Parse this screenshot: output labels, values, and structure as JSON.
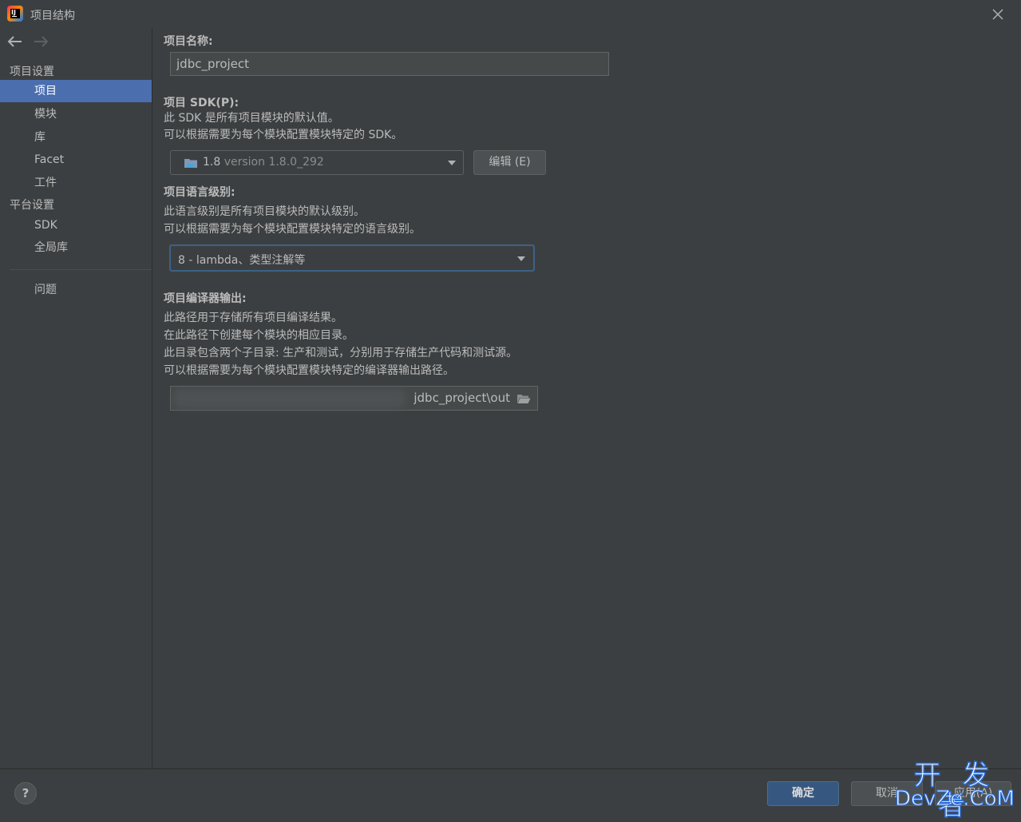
{
  "window": {
    "title": "项目结构"
  },
  "sidebar": {
    "project_settings_label": "项目设置",
    "project_items": [
      "项目",
      "模块",
      "库",
      "Facet",
      "工件"
    ],
    "platform_settings_label": "平台设置",
    "platform_items": [
      "SDK",
      "全局库"
    ],
    "problems_label": "问题",
    "selected": "项目"
  },
  "project": {
    "name_label": "项目名称:",
    "name_value": "jdbc_project",
    "sdk_label": "项目 SDK(P):",
    "sdk_desc1": "此 SDK 是所有项目模块的默认值。",
    "sdk_desc2": "可以根据需要为每个模块配置模块特定的 SDK。",
    "sdk_name": "1.8",
    "sdk_version": "version 1.8.0_292",
    "edit_button": "编辑 (E)",
    "lang_label": "项目语言级别:",
    "lang_desc1": "此语言级别是所有项目模块的默认级别。",
    "lang_desc2": "可以根据需要为每个模块配置模块特定的语言级别。",
    "lang_value": "8 - lambda、类型注解等",
    "output_label": "项目编译器输出:",
    "output_desc1": "此路径用于存储所有项目编译结果。",
    "output_desc2": "在此路径下创建每个模块的相应目录。",
    "output_desc3": "此目录包含两个子目录: 生产和测试，分别用于存储生产代码和测试源。",
    "output_desc4": "可以根据需要为每个模块配置模块特定的编译器输出路径。",
    "output_path": "jdbc_project\\out"
  },
  "footer": {
    "help": "?",
    "ok": "确定",
    "cancel": "取消",
    "apply": "应用(A)"
  },
  "watermark": {
    "line1": "开 发 者",
    "line2": "DevZe.CoM"
  },
  "colors": {
    "background": "#3c3f41",
    "selection": "#4b6eaf",
    "primary_button": "#365880",
    "focus_border": "#3d6185"
  }
}
